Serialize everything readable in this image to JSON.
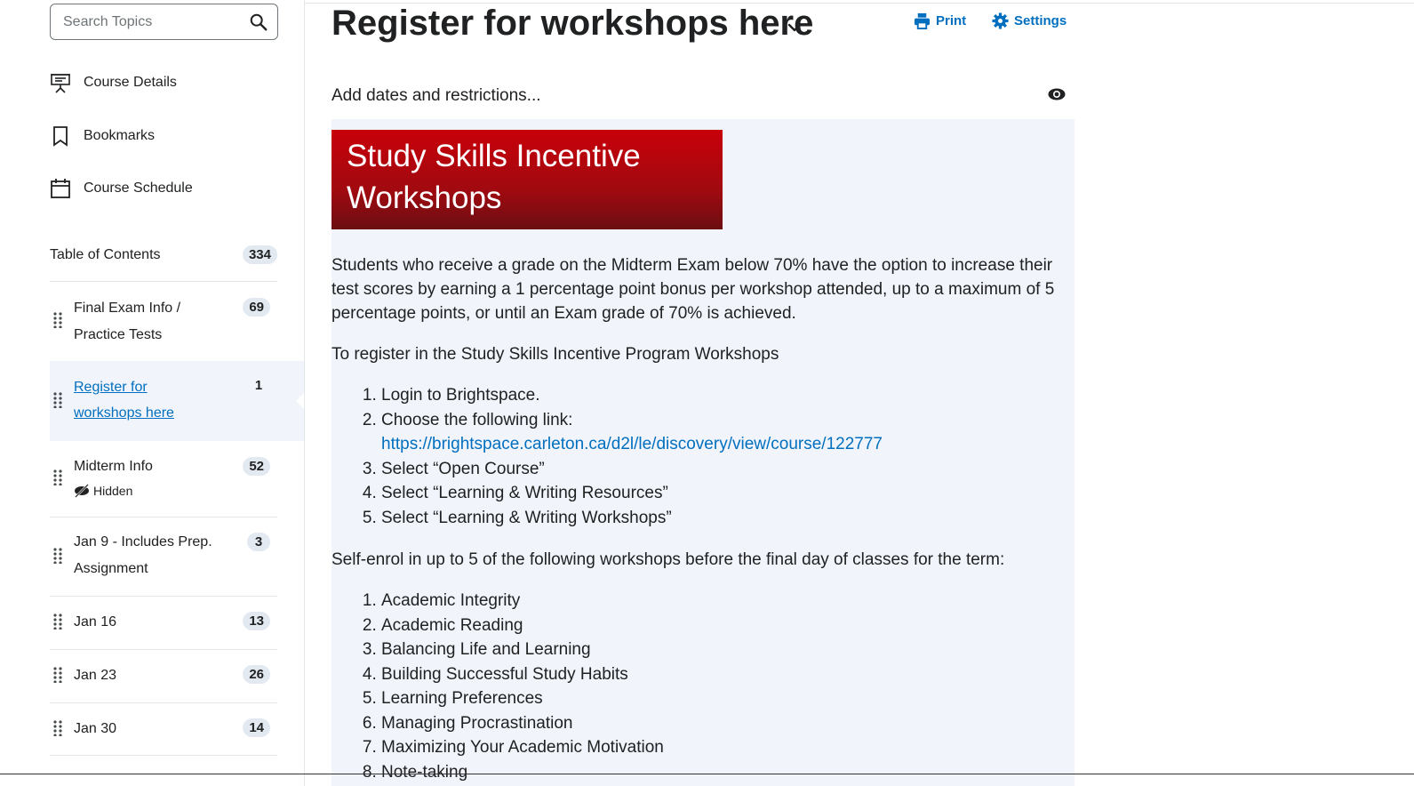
{
  "sidebar": {
    "search_placeholder": "Search Topics",
    "links": [
      {
        "label": "Course Details",
        "icon": "presentation-icon"
      },
      {
        "label": "Bookmarks",
        "icon": "bookmark-icon"
      },
      {
        "label": "Course Schedule",
        "icon": "calendar-icon"
      }
    ],
    "toc": {
      "label": "Table of Contents",
      "count": "334"
    },
    "units": [
      {
        "title_line1": "Final Exam Info /",
        "title_line2": "Practice Tests",
        "count": "69"
      },
      {
        "title_line1": "Register for",
        "title_line2": "workshops here",
        "count": "1",
        "active": true
      },
      {
        "title_line1": "Midterm Info",
        "hidden_label": "Hidden",
        "count": "52"
      },
      {
        "title_line1": "Jan 9 - Includes Prep.",
        "title_line2": "Assignment",
        "count": "3"
      },
      {
        "title_line1": "Jan 16",
        "count": "13"
      },
      {
        "title_line1": "Jan 23",
        "count": "26"
      },
      {
        "title_line1": "Jan 30",
        "count": "14"
      }
    ]
  },
  "main": {
    "title": "Register for workshops here",
    "print_label": "Print",
    "settings_label": "Settings",
    "dates_label": "Add dates and restrictions...",
    "banner_line1": "Study Skills Incentive",
    "banner_line2": "Workshops",
    "intro": "Students who receive a grade on the Midterm Exam below 70% have the option to increase their test scores by earning a 1 percentage point bonus per workshop attended, up to a maximum of 5 percentage points, or until an Exam grade of 70% is achieved.",
    "register_heading": "To register in the Study Skills Incentive Program Workshops",
    "steps": [
      "Login to Brightspace.",
      "Choose the following link:",
      "Select “Open Course”",
      "Select “Learning & Writing Resources”",
      "Select “Learning & Writing Workshops”"
    ],
    "link_url": "https://brightspace.carleton.ca/d2l/le/discovery/view/course/122777",
    "enrol_heading": "Self-enrol in up to 5 of the following workshops before the final day of classes for the term:",
    "workshops": [
      "Academic Integrity",
      "Academic Reading",
      "Balancing Life and Learning",
      "Building Successful Study Habits",
      "Learning Preferences",
      "Managing Procrastination",
      "Maximizing Your Academic Motivation",
      "Note-taking"
    ]
  },
  "colors": {
    "accent": "#006fbf",
    "banner": "#c8000a",
    "panel": "#f1f5fb"
  }
}
